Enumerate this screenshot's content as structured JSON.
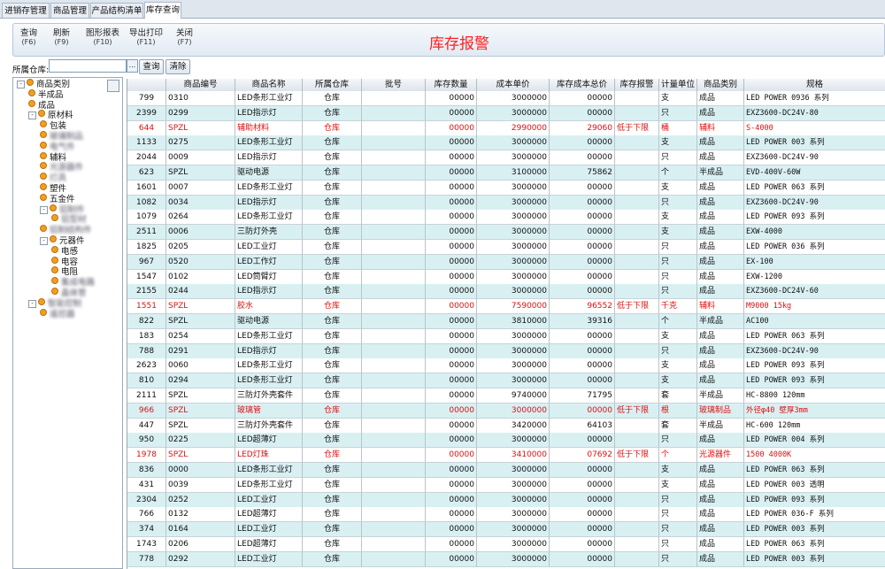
{
  "tabs": [
    "进销存管理",
    "商品管理",
    "产品结构清单",
    "库存查询"
  ],
  "toolbar": {
    "buttons": [
      {
        "label": "查询",
        "key": "(F6)"
      },
      {
        "label": "刷新",
        "key": "(F9)"
      },
      {
        "label": "图形报表",
        "key": "(F10)"
      },
      {
        "label": "导出打印",
        "key": "(F11)"
      },
      {
        "label": "关闭",
        "key": "(F7)"
      }
    ],
    "title": "库存报警"
  },
  "filter": {
    "label": "所属仓库:",
    "value": "",
    "dropdown": "...",
    "query_label": "查询",
    "clear_label": "清除"
  },
  "tree": [
    {
      "label": "商品类别",
      "level": 0,
      "expander": "-"
    },
    {
      "label": "半成品",
      "level": 1
    },
    {
      "label": "成品",
      "level": 1
    },
    {
      "label": "原材料",
      "level": 1,
      "expander": "-"
    },
    {
      "label": "包装",
      "level": 2
    },
    {
      "label": "玻璃制品",
      "level": 2,
      "blur": true
    },
    {
      "label": "电气件",
      "level": 2,
      "blur": true
    },
    {
      "label": "辅料",
      "level": 2
    },
    {
      "label": "光源器件",
      "level": 2,
      "blur": true
    },
    {
      "label": "灯具",
      "level": 2,
      "blur": true
    },
    {
      "label": "塑件",
      "level": 2
    },
    {
      "label": "五金件",
      "level": 2
    },
    {
      "label": "铝制件",
      "level": 2,
      "expander": "-",
      "blur": true
    },
    {
      "label": "铝型材",
      "level": 3,
      "blur": true
    },
    {
      "label": "铝制结构件",
      "level": 2,
      "blur": true
    },
    {
      "label": "元器件",
      "level": 2,
      "expander": "-"
    },
    {
      "label": "电感",
      "level": 3
    },
    {
      "label": "电容",
      "level": 3
    },
    {
      "label": "电阻",
      "level": 3
    },
    {
      "label": "集成电路",
      "level": 3,
      "blur": true
    },
    {
      "label": "晶体管",
      "level": 3,
      "blur": true
    },
    {
      "label": "智能控制",
      "level": 1,
      "expander": "-",
      "blur": true
    },
    {
      "label": "遥控器",
      "level": 2,
      "blur": true
    }
  ],
  "columns": [
    "",
    "商品编号",
    "商品名称",
    "所属仓库",
    "批号",
    "库存数量",
    "成本单价",
    "库存成本总价",
    "库存报警",
    "计量单位",
    "商品类别",
    "规格"
  ],
  "rows": [
    {
      "id": "799",
      "code": "0310",
      "name": "LED条形工业灯",
      "wh": "仓库",
      "batch": "",
      "qty": "00000",
      "unit_cost": "3000000",
      "total": "00000",
      "alarm": "",
      "unit": "支",
      "cat": "成品",
      "spec": "LED POWER 0936 系列",
      "red": false
    },
    {
      "id": "2399",
      "code": "0299",
      "name": "LED指示灯",
      "wh": "仓库",
      "batch": "",
      "qty": "00000",
      "unit_cost": "3000000",
      "total": "00000",
      "alarm": "",
      "unit": "只",
      "cat": "成品",
      "spec": "EXZ3600-DC24V-80",
      "red": false
    },
    {
      "id": "644",
      "code": "SPZL",
      "name": "辅助材料",
      "wh": "仓库",
      "batch": "",
      "qty": "00000",
      "unit_cost": "2990000",
      "total": "29060",
      "alarm": "低于下限",
      "unit": "桶",
      "cat": "辅料",
      "spec": "S-4000",
      "red": true
    },
    {
      "id": "1133",
      "code": "0275",
      "name": "LED条形工业灯",
      "wh": "仓库",
      "batch": "",
      "qty": "00000",
      "unit_cost": "3000000",
      "total": "00000",
      "alarm": "",
      "unit": "支",
      "cat": "成品",
      "spec": "LED POWER 003 系列",
      "red": false
    },
    {
      "id": "2044",
      "code": "0009",
      "name": "LED指示灯",
      "wh": "仓库",
      "batch": "",
      "qty": "00000",
      "unit_cost": "3000000",
      "total": "00000",
      "alarm": "",
      "unit": "只",
      "cat": "成品",
      "spec": "EXZ3600-DC24V-90",
      "red": false
    },
    {
      "id": "623",
      "code": "SPZL",
      "name": "驱动电源",
      "wh": "仓库",
      "batch": "",
      "qty": "00000",
      "unit_cost": "3100000",
      "total": "75862",
      "alarm": "",
      "unit": "个",
      "cat": "半成品",
      "spec": "EVD-400V-60W",
      "red": false
    },
    {
      "id": "1601",
      "code": "0007",
      "name": "LED条形工业灯",
      "wh": "仓库",
      "batch": "",
      "qty": "00000",
      "unit_cost": "3000000",
      "total": "00000",
      "alarm": "",
      "unit": "支",
      "cat": "成品",
      "spec": "LED POWER 063 系列",
      "red": false
    },
    {
      "id": "1082",
      "code": "0034",
      "name": "LED指示灯",
      "wh": "仓库",
      "batch": "",
      "qty": "00000",
      "unit_cost": "3000000",
      "total": "00000",
      "alarm": "",
      "unit": "只",
      "cat": "成品",
      "spec": "EXZ3600-DC24V-90",
      "red": false
    },
    {
      "id": "1079",
      "code": "0264",
      "name": "LED条形工业灯",
      "wh": "仓库",
      "batch": "",
      "qty": "00000",
      "unit_cost": "3000000",
      "total": "00000",
      "alarm": "",
      "unit": "支",
      "cat": "成品",
      "spec": "LED POWER 093 系列",
      "red": false
    },
    {
      "id": "2511",
      "code": "0006",
      "name": "三防灯外壳",
      "wh": "仓库",
      "batch": "",
      "qty": "00000",
      "unit_cost": "3000000",
      "total": "00000",
      "alarm": "",
      "unit": "支",
      "cat": "成品",
      "spec": "EXW-4000",
      "red": false
    },
    {
      "id": "1825",
      "code": "0205",
      "name": "LED工业灯",
      "wh": "仓库",
      "batch": "",
      "qty": "00000",
      "unit_cost": "3000000",
      "total": "00000",
      "alarm": "",
      "unit": "只",
      "cat": "成品",
      "spec": "LED POWER 036 系列",
      "red": false
    },
    {
      "id": "967",
      "code": "0520",
      "name": "LED工作灯",
      "wh": "仓库",
      "batch": "",
      "qty": "00000",
      "unit_cost": "3000000",
      "total": "00000",
      "alarm": "",
      "unit": "只",
      "cat": "成品",
      "spec": "EX-100",
      "red": false
    },
    {
      "id": "1547",
      "code": "0102",
      "name": "LED筒臂灯",
      "wh": "仓库",
      "batch": "",
      "qty": "00000",
      "unit_cost": "3000000",
      "total": "00000",
      "alarm": "",
      "unit": "只",
      "cat": "成品",
      "spec": "EXW-1200",
      "red": false
    },
    {
      "id": "2155",
      "code": "0244",
      "name": "LED指示灯",
      "wh": "仓库",
      "batch": "",
      "qty": "00000",
      "unit_cost": "3000000",
      "total": "00000",
      "alarm": "",
      "unit": "只",
      "cat": "成品",
      "spec": "EXZ3600-DC24V-60",
      "red": false
    },
    {
      "id": "1551",
      "code": "SPZL",
      "name": "胶水",
      "wh": "仓库",
      "batch": "",
      "qty": "00000",
      "unit_cost": "7590000",
      "total": "96552",
      "alarm": "低于下限",
      "unit": "千克",
      "cat": "辅料",
      "spec": "M9000 15kg",
      "red": true
    },
    {
      "id": "822",
      "code": "SPZL",
      "name": "驱动电源",
      "wh": "仓库",
      "batch": "",
      "qty": "00000",
      "unit_cost": "3810000",
      "total": "39316",
      "alarm": "",
      "unit": "个",
      "cat": "半成品",
      "spec": "AC100",
      "red": false
    },
    {
      "id": "183",
      "code": "0254",
      "name": "LED条形工业灯",
      "wh": "仓库",
      "batch": "",
      "qty": "00000",
      "unit_cost": "3000000",
      "total": "00000",
      "alarm": "",
      "unit": "支",
      "cat": "成品",
      "spec": "LED POWER 063 系列",
      "red": false
    },
    {
      "id": "788",
      "code": "0291",
      "name": "LED指示灯",
      "wh": "仓库",
      "batch": "",
      "qty": "00000",
      "unit_cost": "3000000",
      "total": "00000",
      "alarm": "",
      "unit": "只",
      "cat": "成品",
      "spec": "EXZ3600-DC24V-90",
      "red": false
    },
    {
      "id": "2623",
      "code": "0060",
      "name": "LED条形工业灯",
      "wh": "仓库",
      "batch": "",
      "qty": "00000",
      "unit_cost": "3000000",
      "total": "00000",
      "alarm": "",
      "unit": "支",
      "cat": "成品",
      "spec": "LED POWER 093 系列",
      "red": false
    },
    {
      "id": "810",
      "code": "0294",
      "name": "LED条形工业灯",
      "wh": "仓库",
      "batch": "",
      "qty": "00000",
      "unit_cost": "3000000",
      "total": "00000",
      "alarm": "",
      "unit": "支",
      "cat": "成品",
      "spec": "LED POWER 093 系列",
      "red": false
    },
    {
      "id": "2111",
      "code": "SPZL",
      "name": "三防灯外壳套件",
      "wh": "仓库",
      "batch": "",
      "qty": "00000",
      "unit_cost": "9740000",
      "total": "71795",
      "alarm": "",
      "unit": "套",
      "cat": "半成品",
      "spec": "HC-8800 120mm",
      "red": false
    },
    {
      "id": "966",
      "code": "SPZL",
      "name": "玻璃管",
      "wh": "仓库",
      "batch": "",
      "qty": "00000",
      "unit_cost": "3000000",
      "total": "00000",
      "alarm": "低于下限",
      "unit": "根",
      "cat": "玻璃制品",
      "spec": "外径φ40 壁厚3mm",
      "red": true
    },
    {
      "id": "447",
      "code": "SPZL",
      "name": "三防灯外壳套件",
      "wh": "仓库",
      "batch": "",
      "qty": "00000",
      "unit_cost": "3420000",
      "total": "64103",
      "alarm": "",
      "unit": "套",
      "cat": "半成品",
      "spec": "HC-600 120mm",
      "red": false
    },
    {
      "id": "950",
      "code": "0225",
      "name": "LED超薄灯",
      "wh": "仓库",
      "batch": "",
      "qty": "00000",
      "unit_cost": "3000000",
      "total": "00000",
      "alarm": "",
      "unit": "只",
      "cat": "成品",
      "spec": "LED POWER 004 系列",
      "red": false
    },
    {
      "id": "1978",
      "code": "SPZL",
      "name": "LED灯珠",
      "wh": "仓库",
      "batch": "",
      "qty": "00000",
      "unit_cost": "3410000",
      "total": "07692",
      "alarm": "低于下限",
      "unit": "个",
      "cat": "光源器件",
      "spec": "1500 4000K",
      "red": true
    },
    {
      "id": "836",
      "code": "0000",
      "name": "LED条形工业灯",
      "wh": "仓库",
      "batch": "",
      "qty": "00000",
      "unit_cost": "3000000",
      "total": "00000",
      "alarm": "",
      "unit": "支",
      "cat": "成品",
      "spec": "LED POWER 063 系列",
      "red": false
    },
    {
      "id": "431",
      "code": "0039",
      "name": "LED条形工业灯",
      "wh": "仓库",
      "batch": "",
      "qty": "00000",
      "unit_cost": "3000000",
      "total": "00000",
      "alarm": "",
      "unit": "支",
      "cat": "成品",
      "spec": "LED POWER 003 透明",
      "red": false
    },
    {
      "id": "2304",
      "code": "0252",
      "name": "LED工业灯",
      "wh": "仓库",
      "batch": "",
      "qty": "00000",
      "unit_cost": "3000000",
      "total": "00000",
      "alarm": "",
      "unit": "只",
      "cat": "成品",
      "spec": "LED POWER 093 系列",
      "red": false
    },
    {
      "id": "766",
      "code": "0132",
      "name": "LED超薄灯",
      "wh": "仓库",
      "batch": "",
      "qty": "00000",
      "unit_cost": "3000000",
      "total": "00000",
      "alarm": "",
      "unit": "只",
      "cat": "成品",
      "spec": "LED POWER 036-F 系列",
      "red": false
    },
    {
      "id": "374",
      "code": "0164",
      "name": "LED工业灯",
      "wh": "仓库",
      "batch": "",
      "qty": "00000",
      "unit_cost": "3000000",
      "total": "00000",
      "alarm": "",
      "unit": "只",
      "cat": "成品",
      "spec": "LED POWER 003 系列",
      "red": false
    },
    {
      "id": "1743",
      "code": "0206",
      "name": "LED超薄灯",
      "wh": "仓库",
      "batch": "",
      "qty": "00000",
      "unit_cost": "3000000",
      "total": "00000",
      "alarm": "",
      "unit": "只",
      "cat": "成品",
      "spec": "LED POWER 063 系列",
      "red": false
    },
    {
      "id": "778",
      "code": "0292",
      "name": "LED工业灯",
      "wh": "仓库",
      "batch": "",
      "qty": "00000",
      "unit_cost": "3000000",
      "total": "00000",
      "alarm": "",
      "unit": "只",
      "cat": "成品",
      "spec": "LED POWER 003 系列",
      "red": false
    }
  ]
}
